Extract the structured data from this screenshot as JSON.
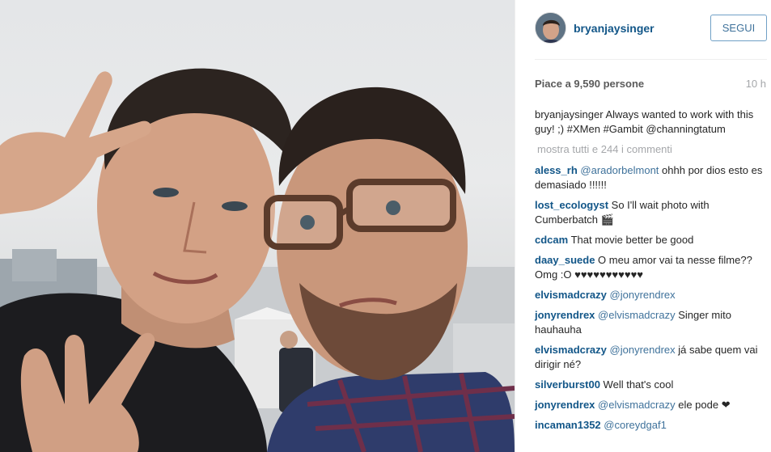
{
  "post": {
    "image_alt": "",
    "author": "bryanjaysinger",
    "follow_label": "SEGUI",
    "likes_text": "Piace a 9,590 persone",
    "time_ago": "10 h",
    "caption": {
      "user": "bryanjaysinger",
      "text": " Always wanted to work with this guy! ;) ",
      "tag1": "#XMen",
      "tag2": "#Gambit",
      "mention": "@channingtatum"
    },
    "show_all_label": "mostra tutti e 244 i commenti"
  },
  "comments": [
    {
      "user": "aless_rh",
      "mention": "@aradorbelmont",
      "text": " ohhh por dios esto es demasiado !!!!!!"
    },
    {
      "user": "lost_ecologyst",
      "mention": "",
      "text": " So I'll wait photo with Cumberbatch 🎬"
    },
    {
      "user": "cdcam",
      "mention": "",
      "text": " That movie better be good"
    },
    {
      "user": "daay_suede",
      "mention": "",
      "text": " O meu amor vai ta nesse filme?? Omg :O ♥♥♥♥♥♥♥♥♥♥♥"
    },
    {
      "user": "elvismadcrazy",
      "mention": "@jonyrendrex",
      "text": ""
    },
    {
      "user": "jonyrendrex",
      "mention": "@elvismadcrazy",
      "text": " Singer mito hauhauha"
    },
    {
      "user": "elvismadcrazy",
      "mention": "@jonyrendrex",
      "text": " já sabe quem vai dirigir né?"
    },
    {
      "user": "silverburst00",
      "mention": "",
      "text": " Well that's cool"
    },
    {
      "user": "jonyrendrex",
      "mention": "@elvismadcrazy",
      "text": " ele pode ❤"
    },
    {
      "user": "incaman1352",
      "mention": "@coreydgaf1",
      "text": ""
    }
  ],
  "colors": {
    "username": "#125688",
    "link": "#3f729b",
    "muted": "#a5a7aa",
    "follow_border": "#70a0c6"
  }
}
